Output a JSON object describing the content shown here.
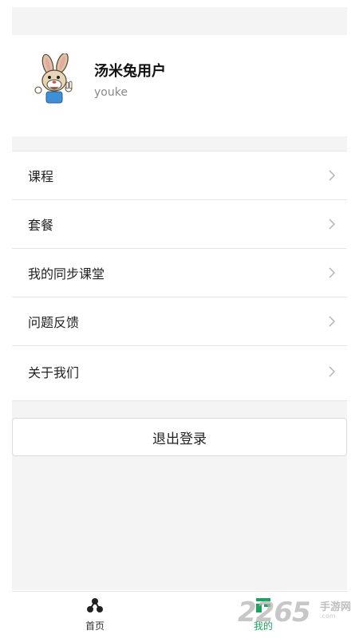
{
  "profile": {
    "username": "汤米兔用户",
    "account": "youke",
    "avatar_icon": "rabbit-avatar-icon"
  },
  "menu": {
    "items": [
      {
        "label": "课程",
        "icon": "chevron-right-icon"
      },
      {
        "label": "套餐",
        "icon": "chevron-right-icon"
      },
      {
        "label": "我的同步课堂",
        "icon": "chevron-right-icon"
      },
      {
        "label": "问题反馈",
        "icon": "chevron-right-icon"
      },
      {
        "label": "关于我们",
        "icon": "chevron-right-icon"
      }
    ]
  },
  "logout": {
    "label": "退出登录"
  },
  "tabbar": {
    "home": {
      "label": "首页",
      "icon": "home-nodes-icon"
    },
    "mine": {
      "label": "我的",
      "icon": "mine-icon",
      "active": true
    }
  },
  "watermark": {
    "text": "2265",
    "sub": "手游网",
    "url": ".com"
  },
  "colors": {
    "background": "#f4f4f4",
    "active_tab": "#1ca261",
    "divider": "#e6e6e6"
  }
}
